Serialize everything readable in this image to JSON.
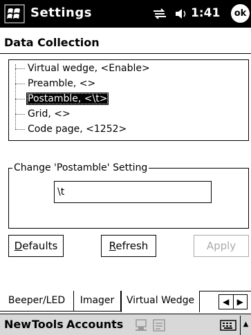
{
  "titlebar": {
    "title": "Settings",
    "time": "1:41",
    "ok_label": "ok",
    "start_icon": "windows-flag-icon",
    "connectivity_icon": "connectivity-icon",
    "volume_icon": "speaker-icon"
  },
  "header": {
    "title": "Data Collection"
  },
  "tree": {
    "items": [
      {
        "label": "Virtual wedge, <Enable>",
        "selected": false
      },
      {
        "label": "Preamble, <>",
        "selected": false
      },
      {
        "label": "Postamble, <\\t>",
        "selected": true
      },
      {
        "label": "Grid, <>",
        "selected": false
      },
      {
        "label": "Code page, <1252>",
        "selected": false
      }
    ]
  },
  "setting": {
    "group_title": "Change 'Postamble' Setting",
    "value": "\\t"
  },
  "buttons": {
    "defaults": "Defaults",
    "refresh": "Refresh",
    "apply": "Apply"
  },
  "tabs": [
    {
      "label": "Beeper/LED",
      "active": false
    },
    {
      "label": "Imager",
      "active": false
    },
    {
      "label": "Virtual Wedge",
      "active": true
    }
  ],
  "menubar": {
    "new": "New",
    "tools": "Tools",
    "accounts": "Accounts"
  },
  "colors": {
    "titlebar_bg": "#000000",
    "menubar_bg": "#d8d8d8",
    "disabled": "#aaaaaa"
  }
}
